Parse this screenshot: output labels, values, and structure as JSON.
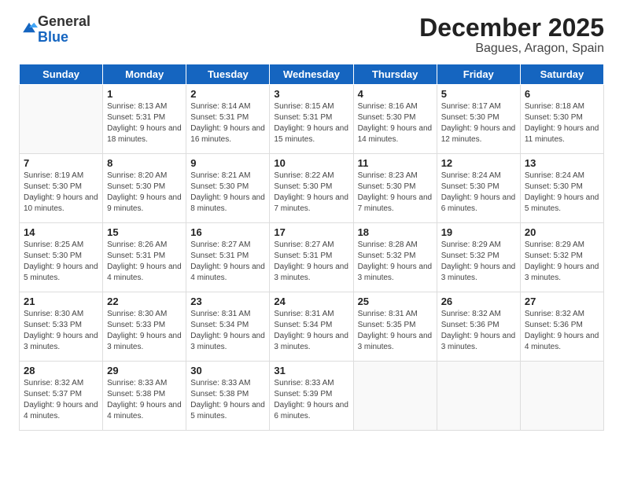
{
  "logo": {
    "general": "General",
    "blue": "Blue"
  },
  "title": "December 2025",
  "subtitle": "Bagues, Aragon, Spain",
  "days_of_week": [
    "Sunday",
    "Monday",
    "Tuesday",
    "Wednesday",
    "Thursday",
    "Friday",
    "Saturday"
  ],
  "weeks": [
    [
      {
        "day": "",
        "sunrise": "",
        "sunset": "",
        "daylight": ""
      },
      {
        "day": "1",
        "sunrise": "Sunrise: 8:13 AM",
        "sunset": "Sunset: 5:31 PM",
        "daylight": "Daylight: 9 hours and 18 minutes."
      },
      {
        "day": "2",
        "sunrise": "Sunrise: 8:14 AM",
        "sunset": "Sunset: 5:31 PM",
        "daylight": "Daylight: 9 hours and 16 minutes."
      },
      {
        "day": "3",
        "sunrise": "Sunrise: 8:15 AM",
        "sunset": "Sunset: 5:31 PM",
        "daylight": "Daylight: 9 hours and 15 minutes."
      },
      {
        "day": "4",
        "sunrise": "Sunrise: 8:16 AM",
        "sunset": "Sunset: 5:30 PM",
        "daylight": "Daylight: 9 hours and 14 minutes."
      },
      {
        "day": "5",
        "sunrise": "Sunrise: 8:17 AM",
        "sunset": "Sunset: 5:30 PM",
        "daylight": "Daylight: 9 hours and 12 minutes."
      },
      {
        "day": "6",
        "sunrise": "Sunrise: 8:18 AM",
        "sunset": "Sunset: 5:30 PM",
        "daylight": "Daylight: 9 hours and 11 minutes."
      }
    ],
    [
      {
        "day": "7",
        "sunrise": "Sunrise: 8:19 AM",
        "sunset": "Sunset: 5:30 PM",
        "daylight": "Daylight: 9 hours and 10 minutes."
      },
      {
        "day": "8",
        "sunrise": "Sunrise: 8:20 AM",
        "sunset": "Sunset: 5:30 PM",
        "daylight": "Daylight: 9 hours and 9 minutes."
      },
      {
        "day": "9",
        "sunrise": "Sunrise: 8:21 AM",
        "sunset": "Sunset: 5:30 PM",
        "daylight": "Daylight: 9 hours and 8 minutes."
      },
      {
        "day": "10",
        "sunrise": "Sunrise: 8:22 AM",
        "sunset": "Sunset: 5:30 PM",
        "daylight": "Daylight: 9 hours and 7 minutes."
      },
      {
        "day": "11",
        "sunrise": "Sunrise: 8:23 AM",
        "sunset": "Sunset: 5:30 PM",
        "daylight": "Daylight: 9 hours and 7 minutes."
      },
      {
        "day": "12",
        "sunrise": "Sunrise: 8:24 AM",
        "sunset": "Sunset: 5:30 PM",
        "daylight": "Daylight: 9 hours and 6 minutes."
      },
      {
        "day": "13",
        "sunrise": "Sunrise: 8:24 AM",
        "sunset": "Sunset: 5:30 PM",
        "daylight": "Daylight: 9 hours and 5 minutes."
      }
    ],
    [
      {
        "day": "14",
        "sunrise": "Sunrise: 8:25 AM",
        "sunset": "Sunset: 5:30 PM",
        "daylight": "Daylight: 9 hours and 5 minutes."
      },
      {
        "day": "15",
        "sunrise": "Sunrise: 8:26 AM",
        "sunset": "Sunset: 5:31 PM",
        "daylight": "Daylight: 9 hours and 4 minutes."
      },
      {
        "day": "16",
        "sunrise": "Sunrise: 8:27 AM",
        "sunset": "Sunset: 5:31 PM",
        "daylight": "Daylight: 9 hours and 4 minutes."
      },
      {
        "day": "17",
        "sunrise": "Sunrise: 8:27 AM",
        "sunset": "Sunset: 5:31 PM",
        "daylight": "Daylight: 9 hours and 3 minutes."
      },
      {
        "day": "18",
        "sunrise": "Sunrise: 8:28 AM",
        "sunset": "Sunset: 5:32 PM",
        "daylight": "Daylight: 9 hours and 3 minutes."
      },
      {
        "day": "19",
        "sunrise": "Sunrise: 8:29 AM",
        "sunset": "Sunset: 5:32 PM",
        "daylight": "Daylight: 9 hours and 3 minutes."
      },
      {
        "day": "20",
        "sunrise": "Sunrise: 8:29 AM",
        "sunset": "Sunset: 5:32 PM",
        "daylight": "Daylight: 9 hours and 3 minutes."
      }
    ],
    [
      {
        "day": "21",
        "sunrise": "Sunrise: 8:30 AM",
        "sunset": "Sunset: 5:33 PM",
        "daylight": "Daylight: 9 hours and 3 minutes."
      },
      {
        "day": "22",
        "sunrise": "Sunrise: 8:30 AM",
        "sunset": "Sunset: 5:33 PM",
        "daylight": "Daylight: 9 hours and 3 minutes."
      },
      {
        "day": "23",
        "sunrise": "Sunrise: 8:31 AM",
        "sunset": "Sunset: 5:34 PM",
        "daylight": "Daylight: 9 hours and 3 minutes."
      },
      {
        "day": "24",
        "sunrise": "Sunrise: 8:31 AM",
        "sunset": "Sunset: 5:34 PM",
        "daylight": "Daylight: 9 hours and 3 minutes."
      },
      {
        "day": "25",
        "sunrise": "Sunrise: 8:31 AM",
        "sunset": "Sunset: 5:35 PM",
        "daylight": "Daylight: 9 hours and 3 minutes."
      },
      {
        "day": "26",
        "sunrise": "Sunrise: 8:32 AM",
        "sunset": "Sunset: 5:36 PM",
        "daylight": "Daylight: 9 hours and 3 minutes."
      },
      {
        "day": "27",
        "sunrise": "Sunrise: 8:32 AM",
        "sunset": "Sunset: 5:36 PM",
        "daylight": "Daylight: 9 hours and 4 minutes."
      }
    ],
    [
      {
        "day": "28",
        "sunrise": "Sunrise: 8:32 AM",
        "sunset": "Sunset: 5:37 PM",
        "daylight": "Daylight: 9 hours and 4 minutes."
      },
      {
        "day": "29",
        "sunrise": "Sunrise: 8:33 AM",
        "sunset": "Sunset: 5:38 PM",
        "daylight": "Daylight: 9 hours and 4 minutes."
      },
      {
        "day": "30",
        "sunrise": "Sunrise: 8:33 AM",
        "sunset": "Sunset: 5:38 PM",
        "daylight": "Daylight: 9 hours and 5 minutes."
      },
      {
        "day": "31",
        "sunrise": "Sunrise: 8:33 AM",
        "sunset": "Sunset: 5:39 PM",
        "daylight": "Daylight: 9 hours and 6 minutes."
      },
      {
        "day": "",
        "sunrise": "",
        "sunset": "",
        "daylight": ""
      },
      {
        "day": "",
        "sunrise": "",
        "sunset": "",
        "daylight": ""
      },
      {
        "day": "",
        "sunrise": "",
        "sunset": "",
        "daylight": ""
      }
    ]
  ]
}
